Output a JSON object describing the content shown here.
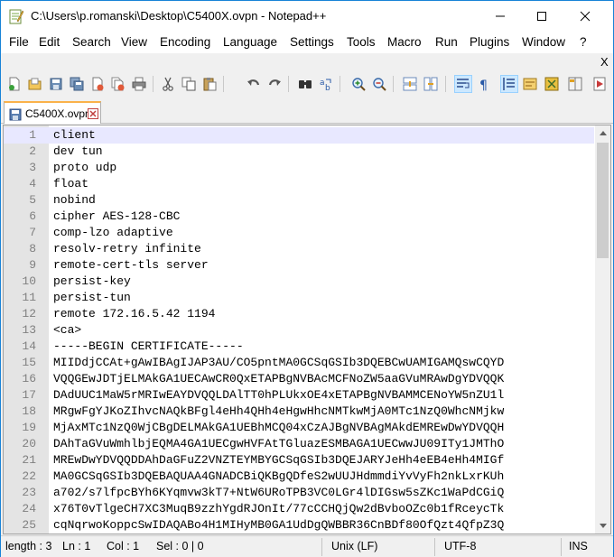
{
  "window": {
    "title": "C:\\Users\\p.romanski\\Desktop\\C5400X.ovpn - Notepad++"
  },
  "menu": {
    "items": [
      "File",
      "Edit",
      "Search",
      "View",
      "Encoding",
      "Language",
      "Settings",
      "Tools",
      "Macro",
      "Run",
      "Plugins",
      "Window",
      "?"
    ],
    "close_label": "X"
  },
  "toolbar": {
    "buttons": [
      "new-file-icon",
      "open-file-icon",
      "save-icon",
      "save-all-icon",
      "close-icon",
      "close-all-icon",
      "print-icon",
      "cut-icon",
      "copy-icon",
      "paste-icon",
      "undo-icon",
      "redo-icon",
      "find-icon",
      "replace-icon",
      "zoom-in-icon",
      "zoom-out-icon",
      "sync-vertical-icon",
      "sync-horizontal-icon",
      "word-wrap-icon",
      "show-all-chars-icon",
      "indent-guide-icon",
      "document-map-icon",
      "function-list-icon",
      "folder-as-workspace-icon",
      "monitoring-icon"
    ]
  },
  "tab": {
    "label": "C5400X.ovpn"
  },
  "editor": {
    "lines": [
      {
        "n": "1",
        "text": "client"
      },
      {
        "n": "2",
        "text": "dev tun"
      },
      {
        "n": "3",
        "text": "proto udp"
      },
      {
        "n": "4",
        "text": "float"
      },
      {
        "n": "5",
        "text": "nobind"
      },
      {
        "n": "6",
        "text": "cipher AES-128-CBC"
      },
      {
        "n": "7",
        "text": "comp-lzo adaptive"
      },
      {
        "n": "8",
        "text": "resolv-retry infinite"
      },
      {
        "n": "9",
        "text": "remote-cert-tls server"
      },
      {
        "n": "10",
        "text": "persist-key"
      },
      {
        "n": "11",
        "text": "persist-tun"
      },
      {
        "n": "12",
        "text": "remote 172.16.5.42 1194"
      },
      {
        "n": "13",
        "text": "<ca>"
      },
      {
        "n": "14",
        "text": "-----BEGIN CERTIFICATE-----"
      },
      {
        "n": "15",
        "text": "MIIDdjCCAt+gAwIBAgIJAP3AU/CO5pntMA0GCSqGSIb3DQEBCwUAMIGAMQswCQYD"
      },
      {
        "n": "16",
        "text": "VQQGEwJDTjELMAkGA1UECAwCR0QxETAPBgNVBAcMCFNoZW5aaGVuMRAwDgYDVQQK"
      },
      {
        "n": "17",
        "text": "DAdUUC1MaW5rMRIwEAYDVQQLDAlTT0hPLUkxOE4xETAPBgNVBAMMCENoYW5nZU1l"
      },
      {
        "n": "18",
        "text": "MRgwFgYJKoZIhvcNAQkBFgl4eHh4QHh4eHgwHhcNMTkwMjA0MTc1NzQ0WhcNMjkw"
      },
      {
        "n": "19",
        "text": "MjAxMTc1NzQ0WjCBgDELMAkGA1UEBhMCQ04xCzAJBgNVBAgMAkdEMREwDwYDVQQH"
      },
      {
        "n": "20",
        "text": "DAhTaGVuWmhlbjEQMA4GA1UECgwHVFAtTGluazESMBAGA1UECwwJU09ITy1JMThO"
      },
      {
        "n": "21",
        "text": "MREwDwYDVQQDDAhDaGFuZ2VNZTEYMBYGCSqGSIb3DQEJARYJeHh4eEB4eHh4MIGf"
      },
      {
        "n": "22",
        "text": "MA0GCSqGSIb3DQEBAQUAA4GNADCBiQKBgQDfeS2wUUJHdmmdiYvVyFh2nkLxrKUh"
      },
      {
        "n": "23",
        "text": "a702/s7lfpcBYh6KYqmvw3kT7+NtW6URoTPB3VC0LGr4lDIGsw5sZKc1WaPdCGiQ"
      },
      {
        "n": "24",
        "text": "x76T0vTlgeCH7XC3MuqB9zzhYgdRJOnIt/77cCCHQjQw2dBvboOZc0b1fRceycTk"
      },
      {
        "n": "25",
        "text": "cqNqrwoKoppcSwIDAQABo4H1MIHyMB0GA1UdDgQWBBR36CnBDf80OfQzt4QfpZ3Q"
      }
    ]
  },
  "status": {
    "length": "length : 3",
    "ln": "Ln : 1",
    "col": "Col : 1",
    "sel": "Sel : 0 | 0",
    "eol": "Unix (LF)",
    "encoding": "UTF-8",
    "mode": "INS"
  },
  "colors": {
    "accent": "#1883d7",
    "current_line": "#e8e8ff",
    "gutter": "#e4e4e4",
    "tab_accent": "#fab24a"
  }
}
